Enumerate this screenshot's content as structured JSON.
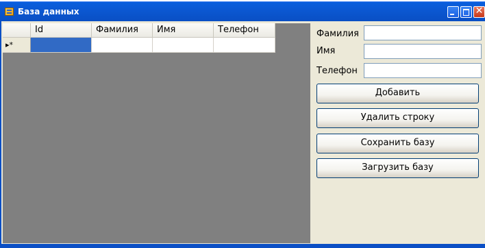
{
  "window": {
    "title": "База данных",
    "controls": {
      "minimize": "minimize-icon",
      "maximize": "maximize-icon",
      "close": "close-icon"
    }
  },
  "grid": {
    "columns": [
      "Id",
      "Фамилия",
      "Имя",
      "Телефон"
    ],
    "new_row_marker": "▸*",
    "rows": [
      {
        "id": "",
        "surname": "",
        "name": "",
        "phone": "",
        "is_new_row": true
      }
    ]
  },
  "form": {
    "surname_label": "Фамилия",
    "surname_value": "",
    "name_label": "Имя",
    "name_value": "",
    "phone_label": "Телефон",
    "phone_value": ""
  },
  "buttons": {
    "add": "Добавить",
    "delete_row": "Удалить строку",
    "save_db": "Сохранить базу",
    "load_db": "Загрузить базу"
  },
  "colors": {
    "titlebar": "#0a58d2",
    "grid_background": "#808080",
    "selected_cell": "#316ac5",
    "window_background": "#ece9d8"
  }
}
